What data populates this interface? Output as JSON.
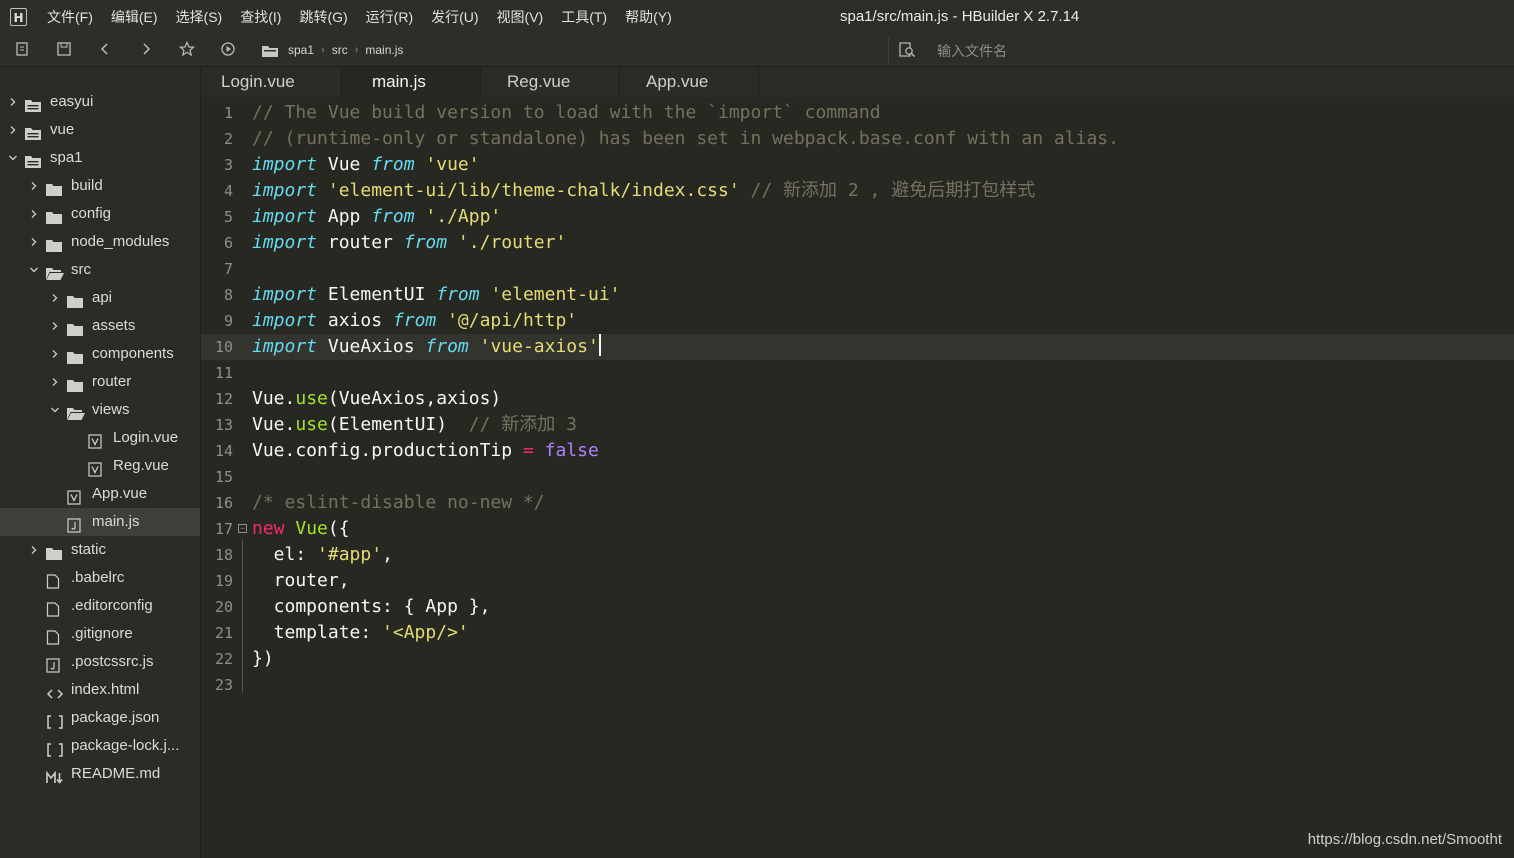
{
  "app": {
    "logo_text": "H",
    "window_title": "spa1/src/main.js - HBuilder X 2.7.14"
  },
  "menu": [
    {
      "label": "文件(F)"
    },
    {
      "label": "编辑(E)"
    },
    {
      "label": "选择(S)"
    },
    {
      "label": "查找(I)"
    },
    {
      "label": "跳转(G)"
    },
    {
      "label": "运行(R)"
    },
    {
      "label": "发行(U)"
    },
    {
      "label": "视图(V)"
    },
    {
      "label": "工具(T)"
    },
    {
      "label": "帮助(Y)"
    }
  ],
  "toolbar": {
    "icons": [
      "new-file-icon",
      "save-icon",
      "back-icon",
      "forward-icon",
      "star-icon",
      "run-icon"
    ],
    "breadcrumb": [
      "spa1",
      "src",
      "main.js"
    ],
    "search_placeholder": "输入文件名"
  },
  "explorer": {
    "items": [
      {
        "label": "easyui",
        "type": "project",
        "expanded": false
      },
      {
        "label": "vue",
        "type": "project",
        "expanded": false
      },
      {
        "label": "spa1",
        "type": "project",
        "expanded": true
      },
      {
        "label": "build",
        "type": "folder",
        "expanded": false
      },
      {
        "label": "config",
        "type": "folder",
        "expanded": false
      },
      {
        "label": "node_modules",
        "type": "folder",
        "expanded": false
      },
      {
        "label": "src",
        "type": "folder",
        "expanded": true
      },
      {
        "label": "api",
        "type": "folder",
        "expanded": false
      },
      {
        "label": "assets",
        "type": "folder",
        "expanded": false
      },
      {
        "label": "components",
        "type": "folder",
        "expanded": false
      },
      {
        "label": "router",
        "type": "folder",
        "expanded": false
      },
      {
        "label": "views",
        "type": "folder",
        "expanded": true
      },
      {
        "label": "Login.vue",
        "type": "vue"
      },
      {
        "label": "Reg.vue",
        "type": "vue"
      },
      {
        "label": "App.vue",
        "type": "vue"
      },
      {
        "label": "main.js",
        "type": "js",
        "selected": true
      },
      {
        "label": "static",
        "type": "folder",
        "expanded": false
      },
      {
        "label": ".babelrc",
        "type": "file"
      },
      {
        "label": ".editorconfig",
        "type": "file"
      },
      {
        "label": ".gitignore",
        "type": "file"
      },
      {
        "label": ".postcssrc.js",
        "type": "js"
      },
      {
        "label": "index.html",
        "type": "html"
      },
      {
        "label": "package.json",
        "type": "json"
      },
      {
        "label": "package-lock.j...",
        "type": "json"
      },
      {
        "label": "README.md",
        "type": "md"
      }
    ]
  },
  "tabs": [
    {
      "label": "Login.vue",
      "active": false
    },
    {
      "label": "main.js",
      "active": true
    },
    {
      "label": "Reg.vue",
      "active": false
    },
    {
      "label": "App.vue",
      "active": false
    }
  ],
  "editor": {
    "current_line": 10,
    "line_numbers": [
      "1",
      "2",
      "3",
      "4",
      "5",
      "6",
      "7",
      "8",
      "9",
      "10",
      "11",
      "12",
      "13",
      "14",
      "15",
      "16",
      "17",
      "18",
      "19",
      "20",
      "21",
      "22",
      "23"
    ],
    "code": {
      "l1": "// The Vue build version to load with the `import` command",
      "l2": "// (runtime-only or standalone) has been set in webpack.base.conf with an alias.",
      "l3_kw": "import",
      "l3_id": " Vue ",
      "l3_from": "from",
      "l3_str": " 'vue'",
      "l4_kw": "import",
      "l4_str": " 'element-ui/lib/theme-chalk/index.css'",
      "l4_cmt": " // 新添加 2 , 避免后期打包样式",
      "l5_kw": "import",
      "l5_id": " App ",
      "l5_from": "from",
      "l5_str": " './App'",
      "l6_kw": "import",
      "l6_id": " router ",
      "l6_from": "from",
      "l6_str": " './router'",
      "l8_kw": "import",
      "l8_id": " ElementUI ",
      "l8_from": "from",
      "l8_str": " 'element-ui'",
      "l9_kw": "import",
      "l9_id": " axios ",
      "l9_from": "from",
      "l9_str": " '@/api/http'",
      "l10_kw": "import",
      "l10_id": " VueAxios ",
      "l10_from": "from",
      "l10_str": " 'vue-axios'",
      "l12_a": "Vue.",
      "l12_fn": "use",
      "l12_b": "(VueAxios,axios)",
      "l13_a": "Vue.",
      "l13_fn": "use",
      "l13_b": "(ElementUI)  ",
      "l13_cmt": "// 新添加 3",
      "l14_a": "Vue.config.productionTip ",
      "l14_op": "=",
      "l14_val": " false",
      "l16": "/* eslint-disable no-new */",
      "l17_new": "new",
      "l17_fn": " Vue",
      "l17_b": "({",
      "l18_a": "  el: ",
      "l18_str": "'#app'",
      "l18_b": ",",
      "l19": "  router,",
      "l20": "  components: { App },",
      "l21_a": "  template: ",
      "l21_str": "'<App/>'",
      "l22": "})"
    }
  },
  "watermark": "https://blog.csdn.net/Smootht"
}
